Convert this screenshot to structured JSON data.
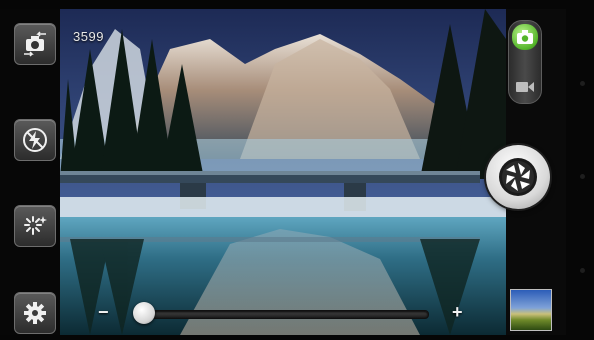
{
  "status": {
    "shots_remaining": "3599"
  },
  "left_controls": [
    {
      "name": "switch-camera-button",
      "icon": "switch-camera-icon"
    },
    {
      "name": "flash-button",
      "icon": "flash-off-icon"
    },
    {
      "name": "effects-button",
      "icon": "sparkle-effects-icon"
    },
    {
      "name": "settings-button",
      "icon": "gear-icon"
    }
  ],
  "mode_switch": {
    "selected": "photo",
    "options": [
      "photo",
      "video"
    ]
  },
  "zoom": {
    "minus_label": "−",
    "plus_label": "+",
    "level": 0.0
  },
  "colors": {
    "accent_green": "#55b52a",
    "control_gray": "#3b3b3b"
  }
}
